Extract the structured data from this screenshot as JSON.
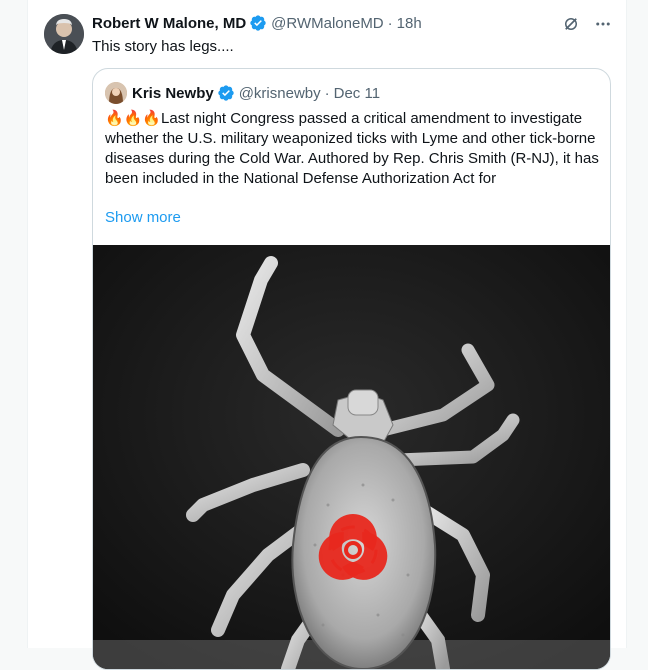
{
  "tweet": {
    "author_name": "Robert W Malone, MD",
    "author_handle": "@RWMaloneMD",
    "separator": "·",
    "time": "18h",
    "text": "This story has legs...."
  },
  "quote": {
    "author_name": "Kris Newby",
    "author_handle": "@krisnewby",
    "separator": "·",
    "date": "Dec 11",
    "emoji": "🔥🔥🔥",
    "text": "Last night Congress passed a critical amendment to investigate whether the U.S. military weaponized ticks with Lyme and other tick-borne diseases during the Cold War.  Authored by Rep. Chris Smith (R-NJ), it has been included in the National Defense Authorization Act for",
    "show_more": "Show more"
  },
  "colors": {
    "accent": "#1d9bf0",
    "verified": "#1d9bf0",
    "biohazard": "#e8281e",
    "muted_text": "#536471"
  },
  "icons": [
    "verified-badge-icon",
    "grok-icon",
    "more-options-icon",
    "biohazard-icon"
  ]
}
